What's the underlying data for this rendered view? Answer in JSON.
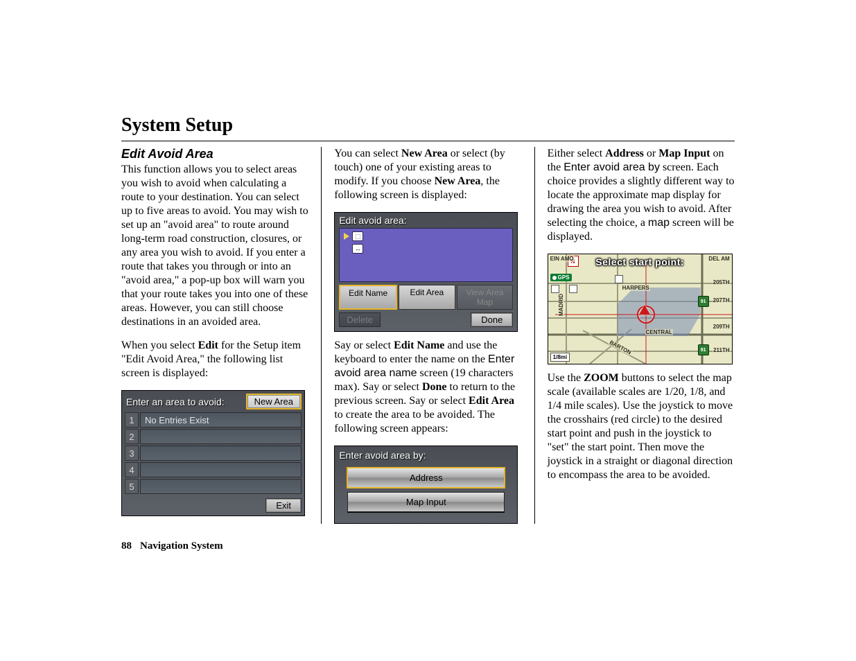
{
  "header": {
    "title": "System Setup"
  },
  "col1": {
    "section_title": "Edit Avoid Area",
    "para1": "This function allows you to select areas you wish to avoid when calculating a route to your destination. You can select up to five areas to avoid. You may wish to set up an \"avoid area\" to route around long-term road construction, closures, or any area you wish to avoid. If you enter a route that takes you through or into an \"avoid area,\" a pop-up box will warn you that your route takes you into one of these areas. However, you can still choose destinations in an avoided area.",
    "para2_a": "When you select ",
    "para2_b": "Edit",
    "para2_c": " for the Setup item \"Edit Avoid Area,\" the following list screen is displayed:",
    "screen1": {
      "title": "Enter an area to avoid:",
      "new_area": "New Area",
      "rows": [
        "1",
        "2",
        "3",
        "4",
        "5"
      ],
      "row1_text": "No Entries Exist",
      "exit": "Exit"
    }
  },
  "col2": {
    "para1_a": "You can select ",
    "para1_b": "New Area",
    "para1_c": " or select (by touch) one of your existing areas to modify. If you choose ",
    "para1_d": "New Area",
    "para1_e": ", the following screen is displayed:",
    "screen2": {
      "title": "Edit avoid area:",
      "edit_name": "Edit Name",
      "edit_area": "Edit Area",
      "view_map": "View Area Map",
      "delete": "Delete",
      "done": "Done"
    },
    "para2_a": "Say or select ",
    "para2_b": "Edit Name",
    "para2_c": " and use the keyboard to enter the name on the ",
    "para2_d": "Enter avoid area name",
    "para2_e": " screen (19 characters max). Say or select ",
    "para2_f": "Done",
    "para2_g": " to return to the previous screen. Say or select ",
    "para2_h": "Edit Area",
    "para2_i": " to create the area to be avoided. The following screen appears:",
    "screen3": {
      "title": "Enter avoid area by:",
      "address": "Address",
      "map_input": "Map Input"
    }
  },
  "col3": {
    "para1_a": "Either select ",
    "para1_b": "Address",
    "para1_c": " or ",
    "para1_d": "Map Input",
    "para1_e": " on the ",
    "para1_f": "Enter avoid area by",
    "para1_g": " screen. Each choice provides a slightly different way to locate the approximate map display for drawing the area you wish to avoid. After selecting the choice, a ",
    "para1_h": "map",
    "para1_i": " screen will be displayed.",
    "map": {
      "title": "Select start point:",
      "gps": "GPS",
      "north": "N",
      "scale": "1/8mi",
      "labels": {
        "amo": "EIN AMO",
        "del": "DEL AM",
        "harpers": "HARPERS",
        "central": "CENTRAL",
        "barton": "BARTON",
        "madrid": "MADRID",
        "s205": "205TH",
        "s207": "207TH",
        "s209": "209TH",
        "s211": "211TH"
      }
    },
    "para2_a": "Use the ",
    "para2_b": "ZOOM",
    "para2_c": " buttons to select the map scale (available scales are 1/20, 1/8, and 1/4 mile scales). Use the joystick to move the crosshairs (red circle) to the desired start point and push in the joystick to \"set\" the start point. Then move the joystick in a straight or diagonal direction to encompass the area to be avoided."
  },
  "footer": {
    "page": "88",
    "label": "Navigation System"
  }
}
